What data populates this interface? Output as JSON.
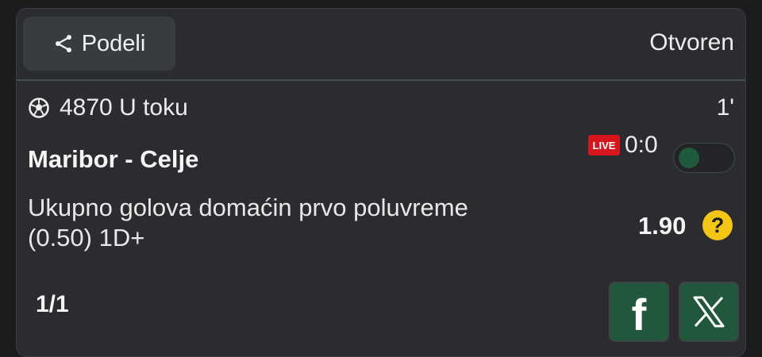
{
  "header": {
    "share_label": "Podeli",
    "status": "Otvoren"
  },
  "event": {
    "id_status": "4870 U toku",
    "minute": "1'",
    "teams": "Maribor - Celje",
    "live_label": "LIVE",
    "score": "0:0"
  },
  "bet": {
    "market_line1": "Ukupno golova domaćin prvo poluvreme",
    "market_line2": "(0.50) 1D+",
    "odd": "1.90",
    "help_symbol": "?"
  },
  "footer": {
    "counter": "1/1",
    "facebook_label": "f"
  },
  "colors": {
    "background": "#2a2c2f",
    "live_red": "#d6161c",
    "social_green": "#21573b",
    "help_yellow": "#f2c516"
  },
  "icons": {
    "share": "share-icon",
    "ball": "soccer-ball-icon",
    "facebook": "facebook-icon",
    "x": "x-icon"
  }
}
